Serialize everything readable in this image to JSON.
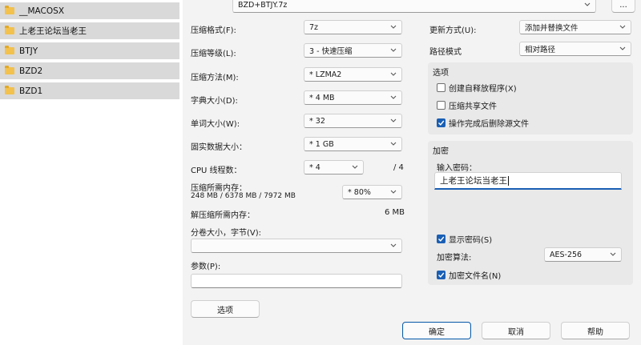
{
  "explorer": {
    "folders": [
      "__MACOSX",
      "上老王论坛当老王",
      "BTJY",
      "BZD2",
      "BZD1"
    ]
  },
  "dialog": {
    "archive_name": "BZD+BTJY.7z",
    "browse_label": "...",
    "left": {
      "format_label": "压缩格式(F):",
      "format_value": "7z",
      "level_label": "压缩等级(L):",
      "level_value": "3 - 快速压缩",
      "method_label": "压缩方法(M):",
      "method_value": "* LZMA2",
      "dict_label": "字典大小(D):",
      "dict_value": "* 4 MB",
      "word_label": "单词大小(W):",
      "word_value": "* 32",
      "solid_label": "固实数据大小：",
      "solid_value": "* 1 GB",
      "cpu_label": "CPU 线程数：",
      "cpu_value": "* 4",
      "cpu_total": "/ 4",
      "mem_label": "压缩所需内存：",
      "mem_detail": "248 MB / 6378 MB / 7972 MB",
      "mem_value": "* 80%",
      "decomp_label": "解压缩所需内存：",
      "decomp_value": "6 MB",
      "split_label": "分卷大小，字节(V):",
      "split_value": "",
      "params_label": "参数(P):",
      "params_value": "",
      "options_button": "选项"
    },
    "right": {
      "update_label": "更新方式(U):",
      "update_value": "添加并替换文件",
      "path_label": "路径模式",
      "path_value": "相对路径",
      "options_group": "选项",
      "sfx_label": "创建自释放程序(X)",
      "sfx_checked": false,
      "shared_label": "压缩共享文件",
      "shared_checked": false,
      "delete_label": "操作完成后删除源文件",
      "delete_checked": true,
      "encrypt_group": "加密",
      "password_label": "输入密码：",
      "password_value": "上老王论坛当老王",
      "show_password_label": "显示密码(S)",
      "show_password_checked": true,
      "enc_method_label": "加密算法:",
      "enc_method_value": "AES-256",
      "encrypt_names_label": "加密文件名(N)",
      "encrypt_names_checked": true
    },
    "buttons": {
      "ok": "确定",
      "cancel": "取消",
      "help": "帮助"
    }
  },
  "colors": {
    "accent": "#1a5fb4",
    "folder": "#f2c14e"
  }
}
